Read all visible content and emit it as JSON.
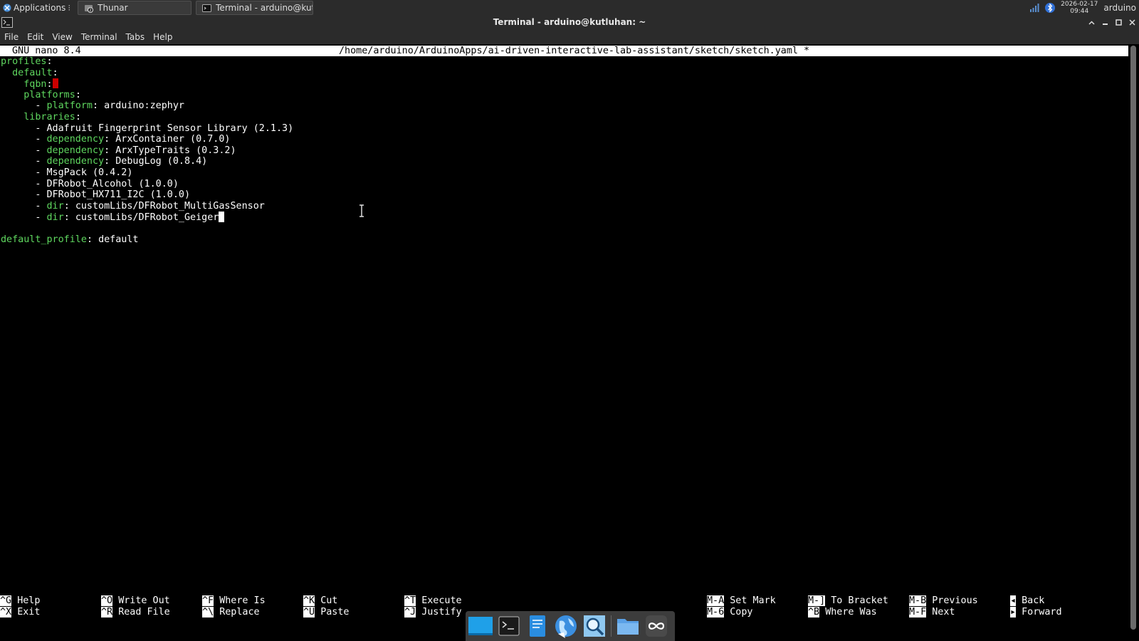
{
  "panel": {
    "applications_label": "Applications",
    "tasks": [
      {
        "label": "Thunar"
      },
      {
        "label": "Terminal - arduino@kutl..."
      }
    ],
    "clock_date": "2026-02-17",
    "clock_time": "09:44",
    "user": "arduino"
  },
  "window": {
    "title": "Terminal - arduino@kutluhan: ~"
  },
  "menubar": {
    "items": [
      "File",
      "Edit",
      "View",
      "Terminal",
      "Tabs",
      "Help"
    ]
  },
  "nano": {
    "version": "GNU nano 8.4",
    "path": "/home/arduino/ArduinoApps/ai-driven-interactive-lab-assistant/sketch/sketch.yaml *"
  },
  "file_lines": [
    {
      "indent": "",
      "key": "profiles",
      "sep": ":",
      "value": ""
    },
    {
      "indent": "  ",
      "key": "default",
      "sep": ":",
      "value": ""
    },
    {
      "indent": "    ",
      "key": "fqbn",
      "sep": ":",
      "value": ""
    },
    {
      "indent": "    ",
      "key": "platforms",
      "sep": ":",
      "value": ""
    },
    {
      "indent": "      ",
      "dash": "- ",
      "key": "platform",
      "sep": ": ",
      "value": "arduino:zephyr"
    },
    {
      "indent": "    ",
      "key": "libraries",
      "sep": ":",
      "value": ""
    },
    {
      "indent": "      ",
      "dash": "- ",
      "key": "",
      "sep": "",
      "value": "Adafruit Fingerprint Sensor Library (2.1.3)"
    },
    {
      "indent": "      ",
      "dash": "- ",
      "key": "dependency",
      "sep": ": ",
      "value": "ArxContainer (0.7.0)"
    },
    {
      "indent": "      ",
      "dash": "- ",
      "key": "dependency",
      "sep": ": ",
      "value": "ArxTypeTraits (0.3.2)"
    },
    {
      "indent": "      ",
      "dash": "- ",
      "key": "dependency",
      "sep": ": ",
      "value": "DebugLog (0.8.4)"
    },
    {
      "indent": "      ",
      "dash": "- ",
      "key": "",
      "sep": "",
      "value": "MsgPack (0.4.2)"
    },
    {
      "indent": "      ",
      "dash": "- ",
      "key": "",
      "sep": "",
      "value": "DFRobot_Alcohol (1.0.0)"
    },
    {
      "indent": "      ",
      "dash": "- ",
      "key": "",
      "sep": "",
      "value": "DFRobot_HX711_I2C (1.0.0)"
    },
    {
      "indent": "      ",
      "dash": "- ",
      "key": "dir",
      "sep": ": ",
      "value": "customLibs/DFRobot_MultiGasSensor"
    },
    {
      "indent": "      ",
      "dash": "- ",
      "key": "dir",
      "sep": ": ",
      "value": "customLibs/DFRobot_Geiger"
    },
    {
      "indent": "",
      "key": "",
      "sep": "",
      "value": ""
    },
    {
      "indent": "",
      "key": "default_profile",
      "sep": ": ",
      "value": "default"
    }
  ],
  "shortcuts": [
    {
      "k1": "^G",
      "l1": "Help",
      "k2": "^X",
      "l2": "Exit"
    },
    {
      "k1": "^O",
      "l1": "Write Out",
      "k2": "^R",
      "l2": "Read File"
    },
    {
      "k1": "^F",
      "l1": "Where Is",
      "k2": "^\\",
      "l2": "Replace"
    },
    {
      "k1": "^K",
      "l1": "Cut",
      "k2": "^U",
      "l2": "Paste"
    },
    {
      "k1": "^T",
      "l1": "Execute",
      "k2": "^J",
      "l2": "Justify"
    },
    {
      "k1": "M-A",
      "l1": "Set Mark",
      "k2": "M-6",
      "l2": "Copy"
    },
    {
      "k1": "M-]",
      "l1": "To Bracket",
      "k2": "^B",
      "l2": "Where Was"
    },
    {
      "k1": "M-B",
      "l1": "Previous",
      "k2": "M-F",
      "l2": "Next"
    },
    {
      "k1": "◂",
      "l1": "Back",
      "k2": "▸",
      "l2": "Forward"
    }
  ],
  "dock": [
    {
      "icon": "desktop-icon"
    },
    {
      "icon": "terminal-icon"
    },
    {
      "icon": "file-manager-icon"
    },
    {
      "icon": "web-browser-icon"
    },
    {
      "icon": "app-finder-icon"
    },
    {
      "icon": "folder-icon"
    },
    {
      "icon": "arduino-icon"
    }
  ],
  "colors": {
    "yaml_key": "#5fd75f",
    "cursor_error": "#cc0000",
    "panel_bg": "#2b2b2b"
  }
}
